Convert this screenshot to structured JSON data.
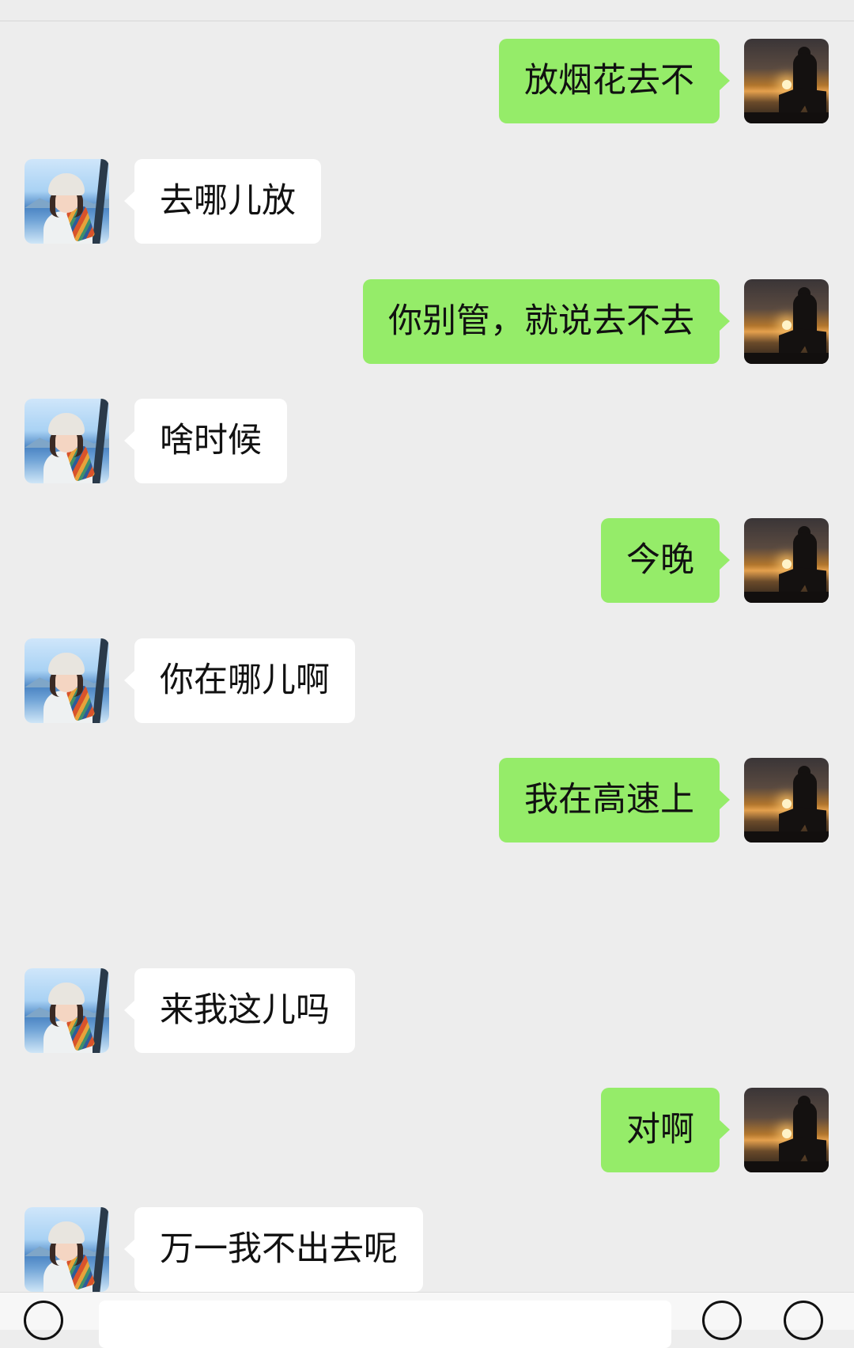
{
  "conversation": {
    "messages": [
      {
        "side": "right",
        "text": "放烟花去不"
      },
      {
        "side": "left",
        "text": "去哪儿放"
      },
      {
        "side": "right",
        "text": "你别管，就说去不去"
      },
      {
        "side": "left",
        "text": "啥时候"
      },
      {
        "side": "right",
        "text": "今晚"
      },
      {
        "side": "left",
        "text": "你在哪儿啊"
      },
      {
        "side": "right",
        "text": "我在高速上"
      },
      {
        "side": "left",
        "text": "来我这儿吗"
      },
      {
        "side": "right",
        "text": "对啊"
      },
      {
        "side": "left",
        "text": "万一我不出去呢"
      }
    ]
  },
  "colors": {
    "background": "#ededed",
    "outgoing_bubble": "#95ec69",
    "incoming_bubble": "#ffffff"
  },
  "icons": {
    "voice": "voice-icon",
    "emoji": "emoji-icon",
    "more": "plus-icon"
  },
  "avatars": {
    "self": "motorcycle-sunset-avatar",
    "contact": "girl-lake-avatar"
  }
}
